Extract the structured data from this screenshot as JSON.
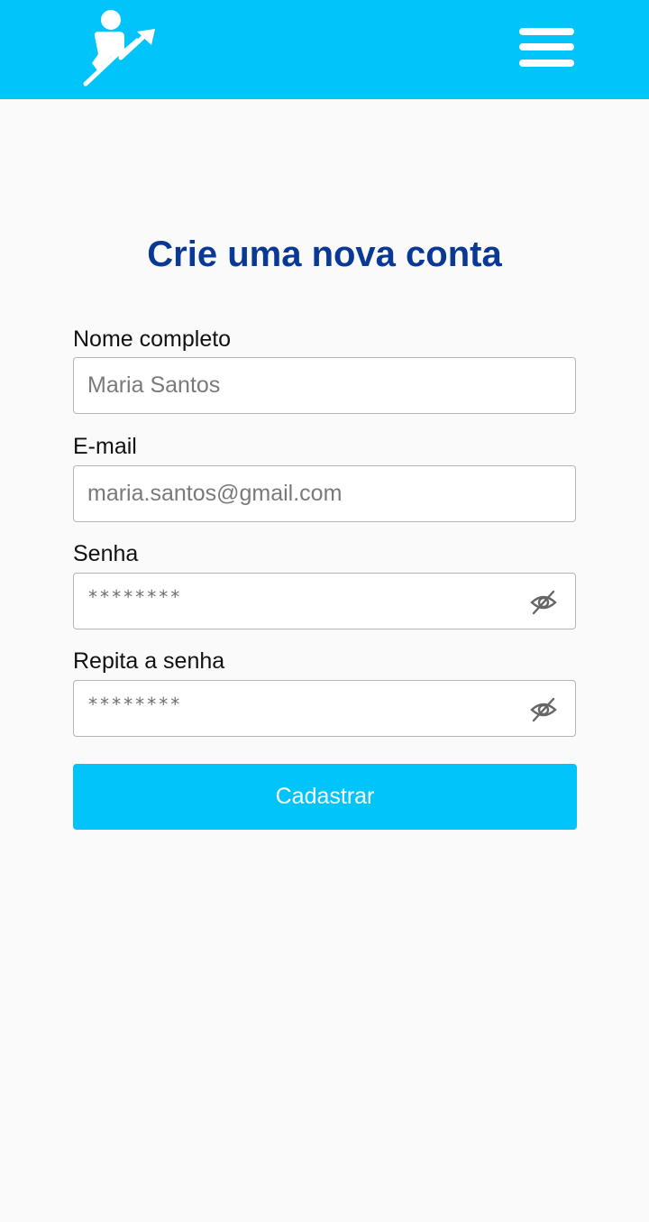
{
  "header": {
    "logo_icon": "person-growth-arrow-icon",
    "menu_icon": "hamburger-menu-icon",
    "background_color": "#00c4fa"
  },
  "form": {
    "title": "Crie uma nova conta",
    "title_color": "#0a3895",
    "fields": [
      {
        "label": "Nome completo",
        "placeholder": "Maria Santos"
      },
      {
        "label": "E-mail",
        "placeholder": "maria.santos@gmail.com"
      },
      {
        "label": "Senha",
        "masked_value": "********",
        "toggle_icon": "eye-slash-icon"
      },
      {
        "label": "Repita a senha",
        "masked_value": "********",
        "toggle_icon": "eye-slash-icon"
      }
    ],
    "submit_label": "Cadastrar",
    "button_color": "#00c4fa"
  }
}
